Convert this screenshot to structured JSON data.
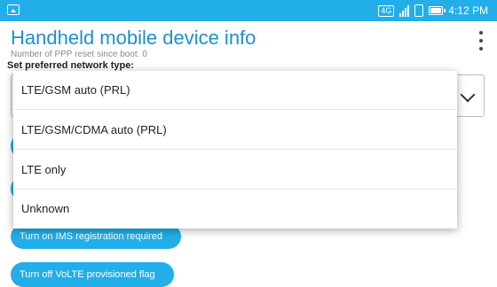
{
  "status_bar": {
    "network_badge": "4G",
    "time": "4:12 PM",
    "accent_color": "#22aee8"
  },
  "header": {
    "title": "Handheld mobile device info",
    "title_color": "#1e8fcf"
  },
  "background": {
    "partial_text": "Number of PPP reset since boot: 0",
    "preferred_network_label": "Set preferred network type:",
    "buttons": [
      "",
      "",
      "Turn on IMS registration required",
      "Turn off VoLTE provisioned flag"
    ]
  },
  "dropdown": {
    "options": [
      "LTE/GSM auto (PRL)",
      "LTE/GSM/CDMA auto (PRL)",
      "LTE only",
      "Unknown"
    ]
  }
}
